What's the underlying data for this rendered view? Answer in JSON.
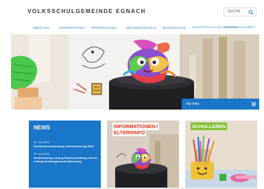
{
  "header": {
    "logo_text": "VOLKSSCHULGEMEINDE EGNACH",
    "search_placeholder": "SUCHE"
  },
  "nav": {
    "items": [
      {
        "label": "ÜBER UNS"
      },
      {
        "label": "KINDERGARTEN"
      },
      {
        "label": "PRIMARSCHULE"
      },
      {
        "label": "SEKUNDARSCHULE"
      },
      {
        "label": "MUSIKSCHULE"
      },
      {
        "label": "AUSSERSCHULISCHE ANGEBOTE"
      },
      {
        "label": "SCHULSOZIALARBEIT"
      }
    ]
  },
  "hero": {
    "caption": "Top links",
    "accent_color": "#1976c8"
  },
  "tiles": {
    "news": {
      "title": "NEWS",
      "items": [
        {
          "date": "15. Juni 2026",
          "text": "Gemeindeversammlung Jahresrechnung 2025"
        },
        {
          "date": "15. Juni 2026",
          "text": "Neubesetzung Leitung Finanzverwaltung und Co-Leitung Schulergänzende Betreuung"
        }
      ]
    },
    "info": {
      "title_line1": "INFORMATIONEN /",
      "title_line2": "ELTERNINFO"
    },
    "school": {
      "title": "SCHULLEBEN"
    }
  },
  "colors": {
    "blue": "#1976c8",
    "red": "#e8351f",
    "green": "#7cbf2f"
  }
}
